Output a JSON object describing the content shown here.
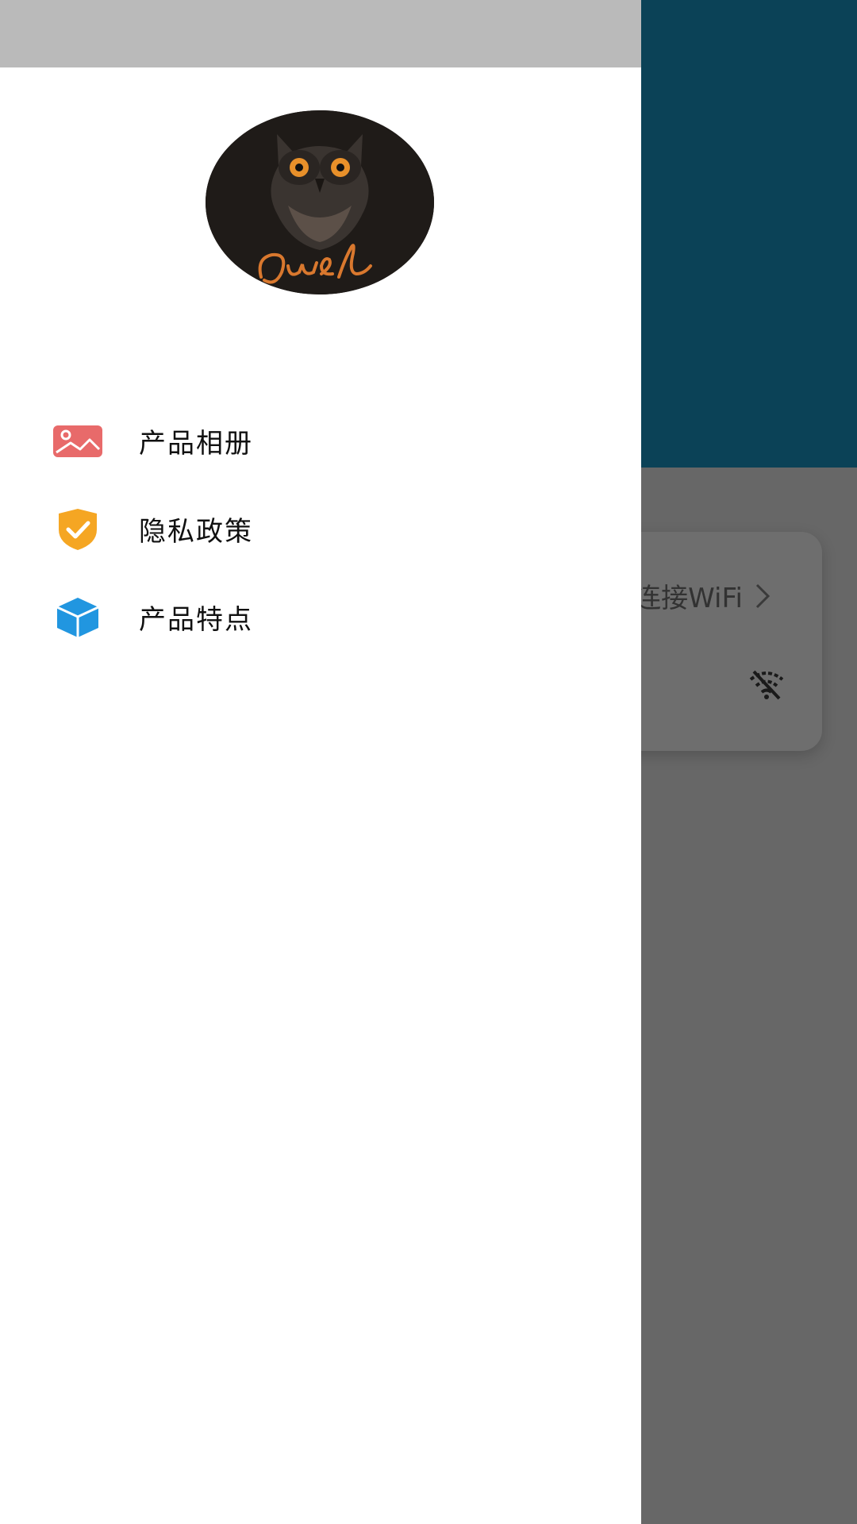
{
  "background_screen": {
    "header_color": "#0b4257",
    "wifi_card": {
      "link_text": "连接WiFi",
      "chevron_icon": "chevron-right-icon",
      "status_icon": "wifi-off-icon"
    }
  },
  "drawer": {
    "avatar_icon": "owl-logo",
    "menu": [
      {
        "label": "产品相册",
        "icon": "image-icon",
        "color": "#e86a6a"
      },
      {
        "label": "隐私政策",
        "icon": "shield-check-icon",
        "color": "#f5a623"
      },
      {
        "label": "产品特点",
        "icon": "cube-icon",
        "color": "#2196e0"
      }
    ]
  }
}
